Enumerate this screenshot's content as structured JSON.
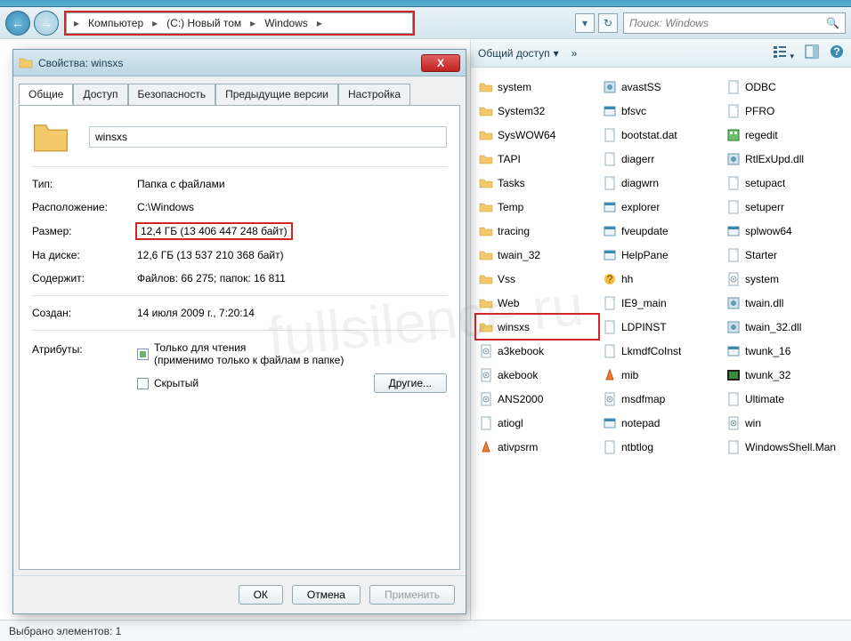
{
  "navigation": {
    "breadcrumbs": [
      "Компьютер",
      "(C:) Новый том",
      "Windows"
    ],
    "search_placeholder": "Поиск: Windows"
  },
  "toolbar": {
    "share_label": "Общий доступ",
    "more": "»"
  },
  "statusbar": {
    "text": "Выбрано элементов: 1"
  },
  "files": {
    "col1": [
      {
        "name": "system",
        "type": "folder"
      },
      {
        "name": "System32",
        "type": "folder"
      },
      {
        "name": "SysWOW64",
        "type": "folder"
      },
      {
        "name": "TAPI",
        "type": "folder"
      },
      {
        "name": "Tasks",
        "type": "folder"
      },
      {
        "name": "Temp",
        "type": "folder"
      },
      {
        "name": "tracing",
        "type": "folder"
      },
      {
        "name": "twain_32",
        "type": "folder"
      },
      {
        "name": "Vss",
        "type": "folder"
      },
      {
        "name": "Web",
        "type": "folder"
      },
      {
        "name": "winsxs",
        "type": "folder",
        "highlighted": true
      },
      {
        "name": "a3kebook",
        "type": "ico"
      },
      {
        "name": "akebook",
        "type": "ico"
      },
      {
        "name": "ANS2000",
        "type": "ini"
      },
      {
        "name": "atiogl",
        "type": "file"
      },
      {
        "name": "ativpsrm",
        "type": "vlc"
      }
    ],
    "col2": [
      {
        "name": "avastSS",
        "type": "app"
      },
      {
        "name": "bfsvc",
        "type": "exe"
      },
      {
        "name": "bootstat.dat",
        "type": "file"
      },
      {
        "name": "diagerr",
        "type": "file"
      },
      {
        "name": "diagwrn",
        "type": "file"
      },
      {
        "name": "explorer",
        "type": "exe"
      },
      {
        "name": "fveupdate",
        "type": "exe"
      },
      {
        "name": "HelpPane",
        "type": "exe"
      },
      {
        "name": "hh",
        "type": "help"
      },
      {
        "name": "IE9_main",
        "type": "file"
      },
      {
        "name": "LDPINST",
        "type": "file"
      },
      {
        "name": "LkmdfCoInst",
        "type": "file"
      },
      {
        "name": "mib",
        "type": "vlc"
      },
      {
        "name": "msdfmap",
        "type": "ini"
      },
      {
        "name": "notepad",
        "type": "exe"
      },
      {
        "name": "ntbtlog",
        "type": "file"
      }
    ],
    "col3": [
      {
        "name": "ODBC",
        "type": "file"
      },
      {
        "name": "PFRO",
        "type": "file"
      },
      {
        "name": "regedit",
        "type": "reg"
      },
      {
        "name": "RtlExUpd.dll",
        "type": "dll"
      },
      {
        "name": "setupact",
        "type": "file"
      },
      {
        "name": "setuperr",
        "type": "file"
      },
      {
        "name": "splwow64",
        "type": "exe"
      },
      {
        "name": "Starter",
        "type": "file"
      },
      {
        "name": "system",
        "type": "ini"
      },
      {
        "name": "twain.dll",
        "type": "dll"
      },
      {
        "name": "twain_32.dll",
        "type": "dll"
      },
      {
        "name": "twunk_16",
        "type": "exe"
      },
      {
        "name": "twunk_32",
        "type": "dos"
      },
      {
        "name": "Ultimate",
        "type": "file"
      },
      {
        "name": "win",
        "type": "ini"
      },
      {
        "name": "WindowsShell.Man",
        "type": "file"
      }
    ]
  },
  "dialog": {
    "title": "Свойства: winsxs",
    "tabs": [
      "Общие",
      "Доступ",
      "Безопасность",
      "Предыдущие версии",
      "Настройка"
    ],
    "folder_name": "winsxs",
    "rows": {
      "type_label": "Тип:",
      "type_value": "Папка с файлами",
      "location_label": "Расположение:",
      "location_value": "C:\\Windows",
      "size_label": "Размер:",
      "size_value": "12,4 ГБ (13 406 447 248 байт)",
      "disk_label": "На диске:",
      "disk_value": "12,6 ГБ (13 537 210 368 байт)",
      "contains_label": "Содержит:",
      "contains_value": "Файлов: 66 275; папок: 16 811",
      "created_label": "Создан:",
      "created_value": "14 июля 2009 г., 7:20:14",
      "attr_label": "Атрибуты:",
      "readonly_label": "Только для чтения",
      "readonly_note": "(применимо только к файлам в папке)",
      "hidden_label": "Скрытый",
      "other_btn": "Другие..."
    },
    "buttons": {
      "ok": "ОК",
      "cancel": "Отмена",
      "apply": "Применить"
    }
  },
  "watermark": "fullsilence.ru"
}
